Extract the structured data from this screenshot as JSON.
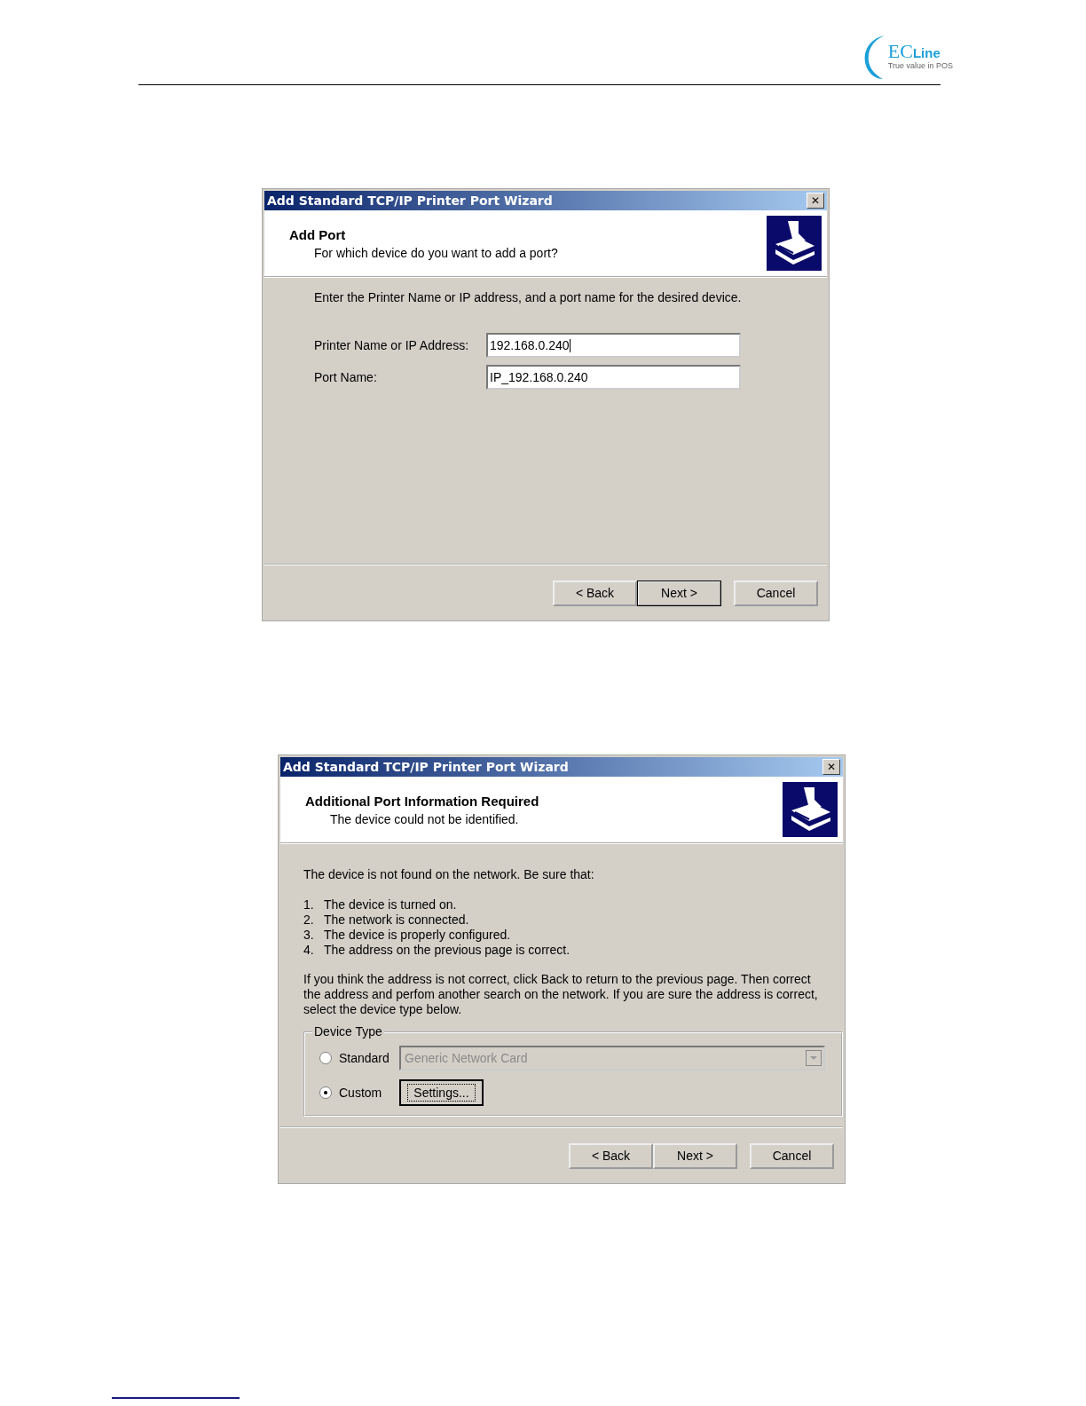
{
  "header": {
    "logo": {
      "mark": "EC",
      "name": "Line",
      "tagline": "True value in POS"
    }
  },
  "dialogs": [
    {
      "title": "Add Standard TCP/IP Printer Port Wizard",
      "close": "✕",
      "heading": "Add Port",
      "subheading": "For which device do you want to add a port?",
      "intro": "Enter the Printer Name or IP address, and a port name for the desired device.",
      "fields": [
        {
          "label": "Printer Name or IP Address:",
          "value": "192.168.0.240",
          "focused": true
        },
        {
          "label": "Port Name:",
          "value": "IP_192.168.0.240",
          "focused": false
        }
      ],
      "buttons": [
        {
          "label": "< Back",
          "default": false
        },
        {
          "label": "Next >",
          "default": true
        },
        {
          "label": "Cancel",
          "default": false
        }
      ]
    },
    {
      "title": "Add Standard TCP/IP Printer Port Wizard",
      "close": "✕",
      "heading": "Additional Port Information Required",
      "subheading": "The device could not be identified.",
      "intro": "The device is not found on the network.  Be sure that:",
      "list": [
        {
          "number": "1.",
          "text": "The device is turned on."
        },
        {
          "number": "2.",
          "text": "The network is connected."
        },
        {
          "number": "3.",
          "text": "The device is properly configured."
        },
        {
          "number": "4.",
          "text": "The address on the previous page is correct."
        }
      ],
      "note": "If you think the address is not correct, click Back to return to the previous page.  Then correct the address and perfom another search on the network.  If you are sure the address is correct, select the device type below.",
      "group": {
        "legend": "Device Type",
        "options": [
          {
            "label": "Standard",
            "selected": false,
            "kind": "dropdown",
            "value": "Generic Network Card",
            "disabled": true
          },
          {
            "label": "Custom",
            "selected": true,
            "kind": "button",
            "value": "Settings...",
            "focused": true
          }
        ]
      },
      "buttons": [
        {
          "label": "< Back",
          "default": false
        },
        {
          "label": "Next >",
          "default": false
        },
        {
          "label": "Cancel",
          "default": false
        }
      ]
    }
  ]
}
